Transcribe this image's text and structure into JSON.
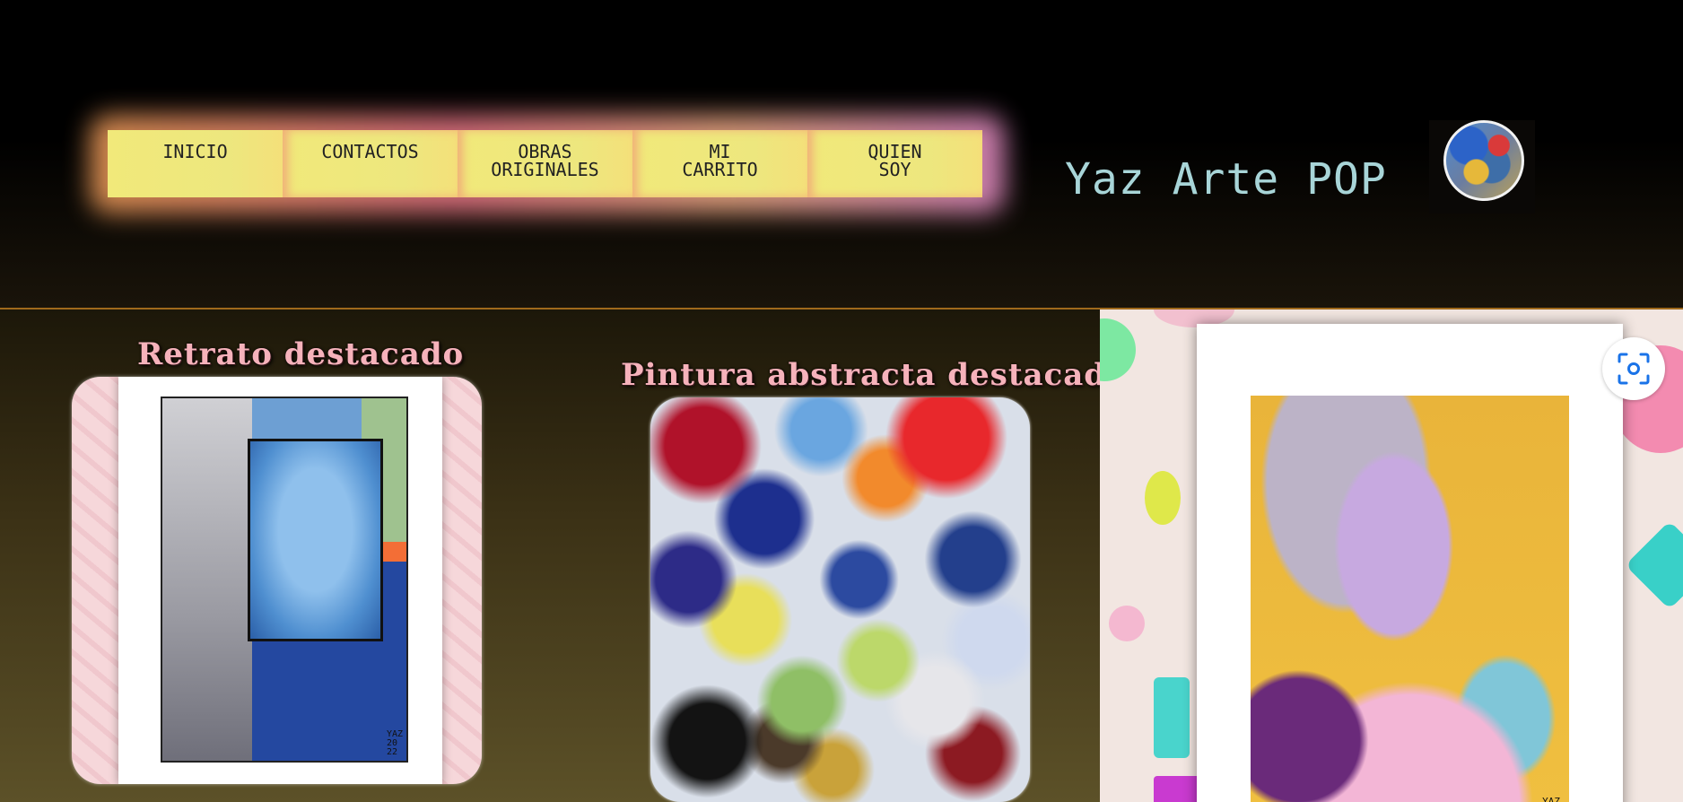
{
  "nav": {
    "items": [
      {
        "label": "INICIO"
      },
      {
        "label": "CONTACTOS"
      },
      {
        "label": "OBRAS\nORIGINALES"
      },
      {
        "label": "MI\nCARRITO"
      },
      {
        "label": "QUIEN\nSOY"
      }
    ]
  },
  "header": {
    "title": "Yaz Arte POP"
  },
  "featured": {
    "portrait_title": "Retrato destacado",
    "abstract_title": "Pintura abstracta destacada"
  },
  "artwork": {
    "signature": "YAZ\n20\n22"
  },
  "colors": {
    "nav_button": "#f1e97a",
    "title": "#a8d5d8",
    "feature_title": "#f6b2bb",
    "lens_icon": "#1a73e8"
  },
  "icons": {
    "avatar": "profile-avatar",
    "lens": "lens-icon"
  }
}
